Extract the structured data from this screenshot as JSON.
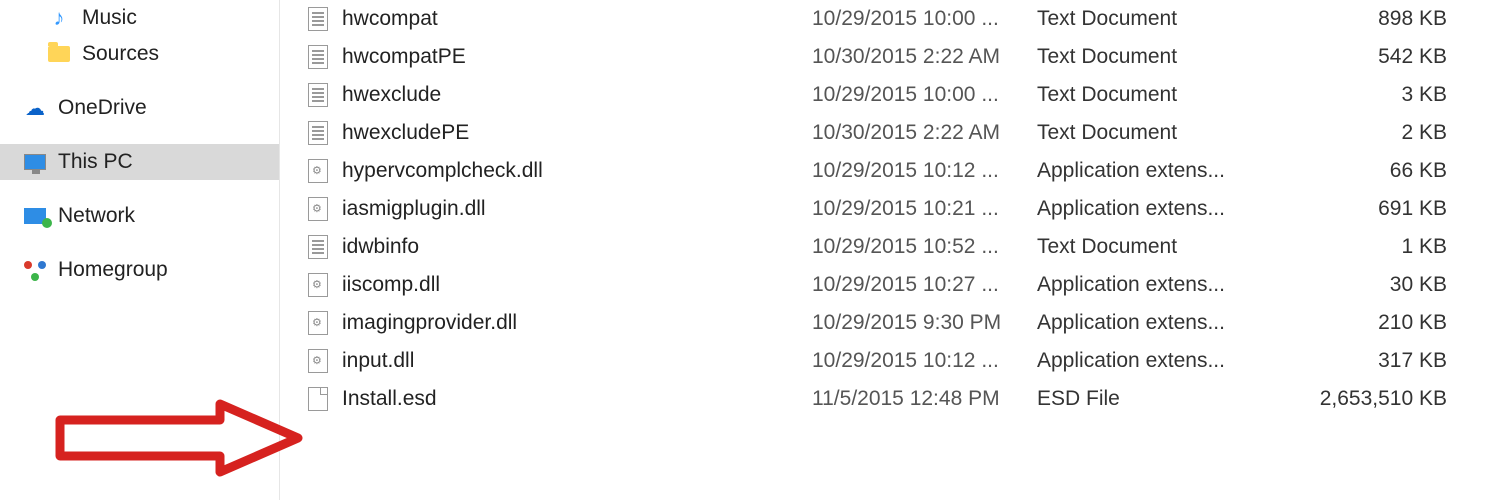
{
  "sidebar": {
    "items": [
      {
        "label": "Music",
        "icon": "music-icon",
        "indent": true,
        "group_start": false,
        "selected": false
      },
      {
        "label": "Sources",
        "icon": "folder-icon",
        "indent": true,
        "group_start": false,
        "selected": false
      },
      {
        "label": "OneDrive",
        "icon": "onedrive-icon",
        "indent": false,
        "group_start": true,
        "selected": false
      },
      {
        "label": "This PC",
        "icon": "pc-icon",
        "indent": false,
        "group_start": true,
        "selected": true
      },
      {
        "label": "Network",
        "icon": "network-icon",
        "indent": false,
        "group_start": true,
        "selected": false
      },
      {
        "label": "Homegroup",
        "icon": "homegroup-icon",
        "indent": false,
        "group_start": true,
        "selected": false
      }
    ]
  },
  "files": [
    {
      "icon": "text",
      "name": "hwcompat",
      "date": "10/29/2015 10:00 ...",
      "type": "Text Document",
      "size": "898 KB"
    },
    {
      "icon": "text",
      "name": "hwcompatPE",
      "date": "10/30/2015 2:22 AM",
      "type": "Text Document",
      "size": "542 KB"
    },
    {
      "icon": "text",
      "name": "hwexclude",
      "date": "10/29/2015 10:00 ...",
      "type": "Text Document",
      "size": "3 KB"
    },
    {
      "icon": "text",
      "name": "hwexcludePE",
      "date": "10/30/2015 2:22 AM",
      "type": "Text Document",
      "size": "2 KB"
    },
    {
      "icon": "dll",
      "name": "hypervcomplcheck.dll",
      "date": "10/29/2015 10:12 ...",
      "type": "Application extens...",
      "size": "66 KB"
    },
    {
      "icon": "dll",
      "name": "iasmigplugin.dll",
      "date": "10/29/2015 10:21 ...",
      "type": "Application extens...",
      "size": "691 KB"
    },
    {
      "icon": "text",
      "name": "idwbinfo",
      "date": "10/29/2015 10:52 ...",
      "type": "Text Document",
      "size": "1 KB"
    },
    {
      "icon": "dll",
      "name": "iiscomp.dll",
      "date": "10/29/2015 10:27 ...",
      "type": "Application extens...",
      "size": "30 KB"
    },
    {
      "icon": "dll",
      "name": "imagingprovider.dll",
      "date": "10/29/2015 9:30 PM",
      "type": "Application extens...",
      "size": "210 KB"
    },
    {
      "icon": "dll",
      "name": "input.dll",
      "date": "10/29/2015 10:12 ...",
      "type": "Application extens...",
      "size": "317 KB"
    },
    {
      "icon": "blank",
      "name": "Install.esd",
      "date": "11/5/2015 12:48 PM",
      "type": "ESD File",
      "size": "2,653,510 KB"
    }
  ]
}
